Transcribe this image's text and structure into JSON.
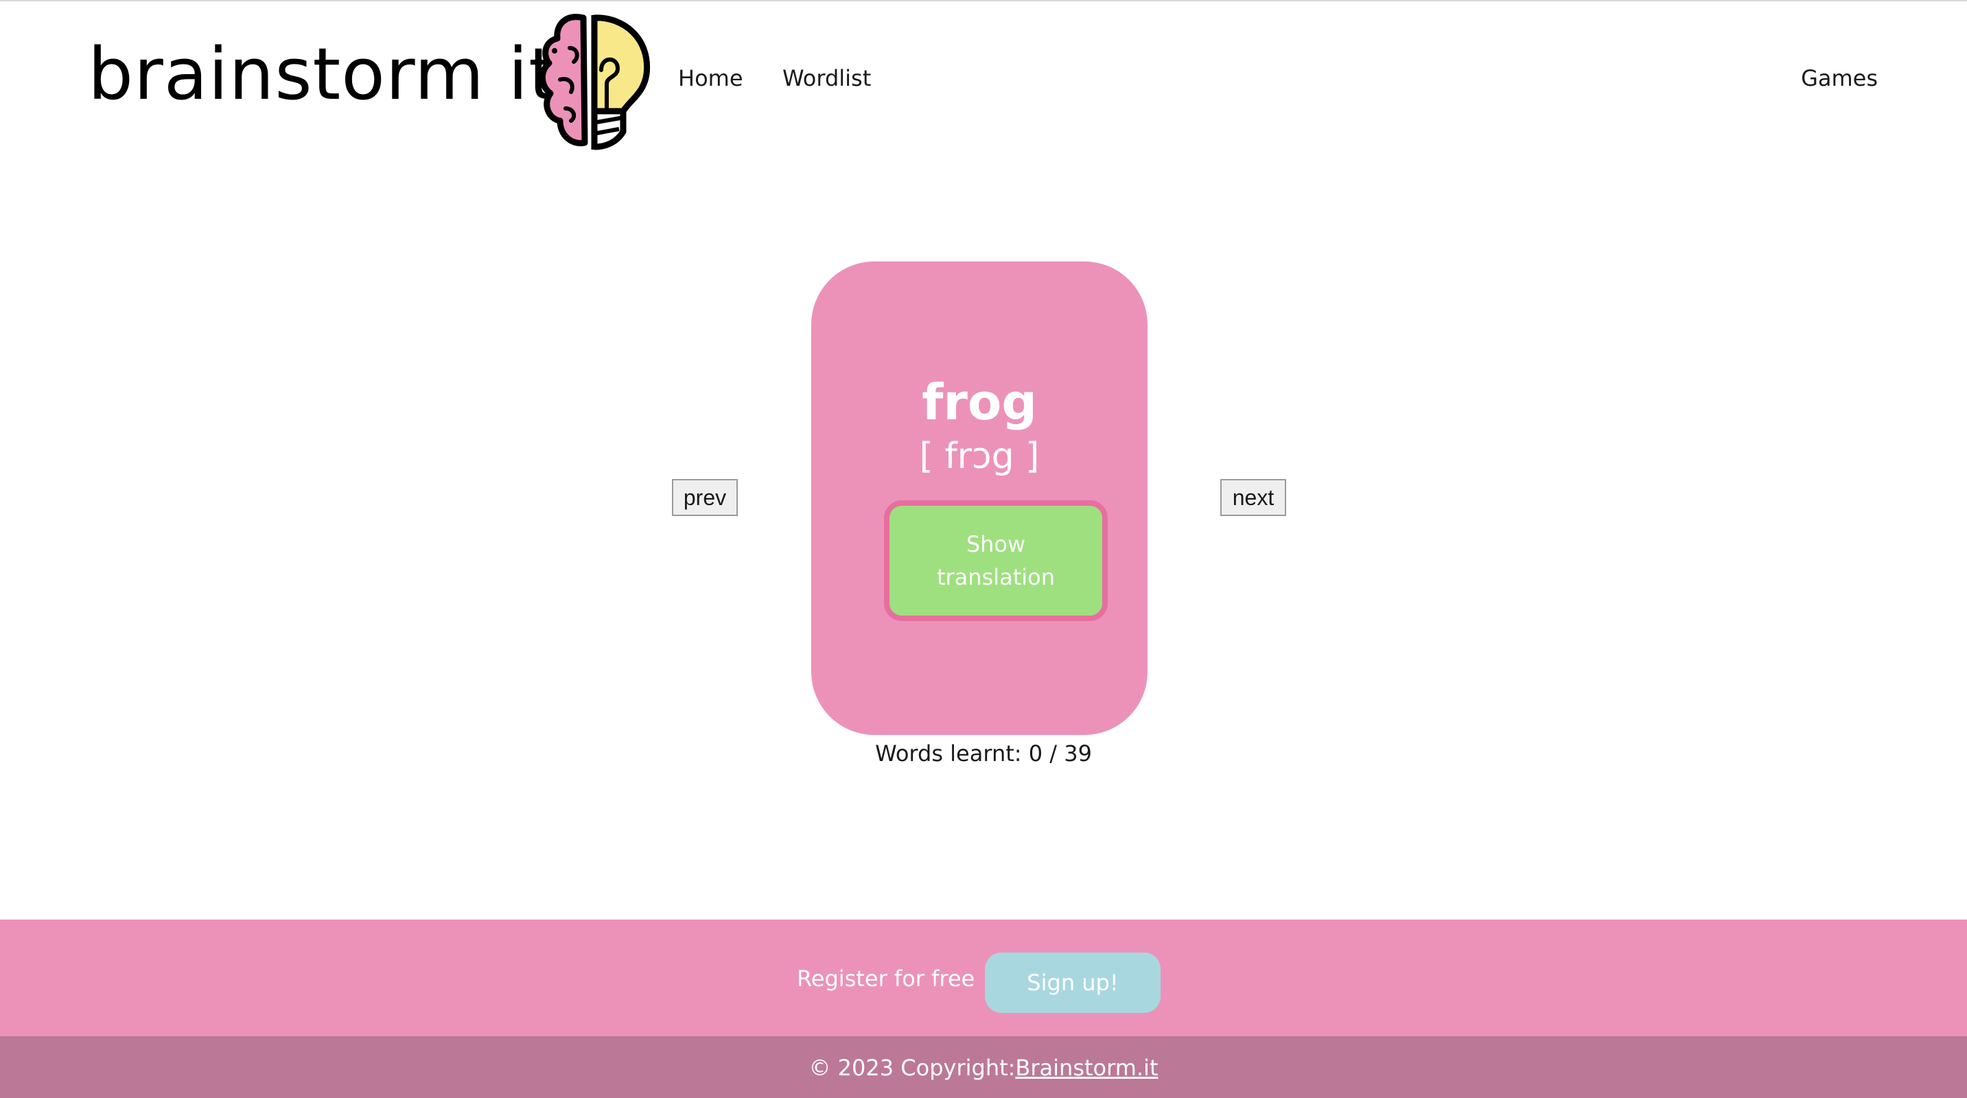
{
  "header": {
    "brand": "brainstorm it!",
    "logo_icon": "brain-lightbulb-icon",
    "nav": {
      "home": "Home",
      "wordlist": "Wordlist",
      "games": "Games"
    }
  },
  "flashcard": {
    "word": "frog",
    "phonetic": "[ frɔg ]",
    "show_translation_label": "Show translation",
    "prev_label": "prev",
    "next_label": "next",
    "progress_text": "Words learnt: 0 / 39"
  },
  "footer": {
    "register_text": "Register for free",
    "signup_label": "Sign up!",
    "copyright_prefix": "© 2023 Copyright:",
    "copyright_link": "Brainstorm.it"
  },
  "colors": {
    "card": "#ec92b9",
    "button_green": "#9ee07f",
    "button_border": "#e76f9f",
    "signup_blue": "#a9d7e0",
    "footer_bottom": "#bc7897"
  }
}
